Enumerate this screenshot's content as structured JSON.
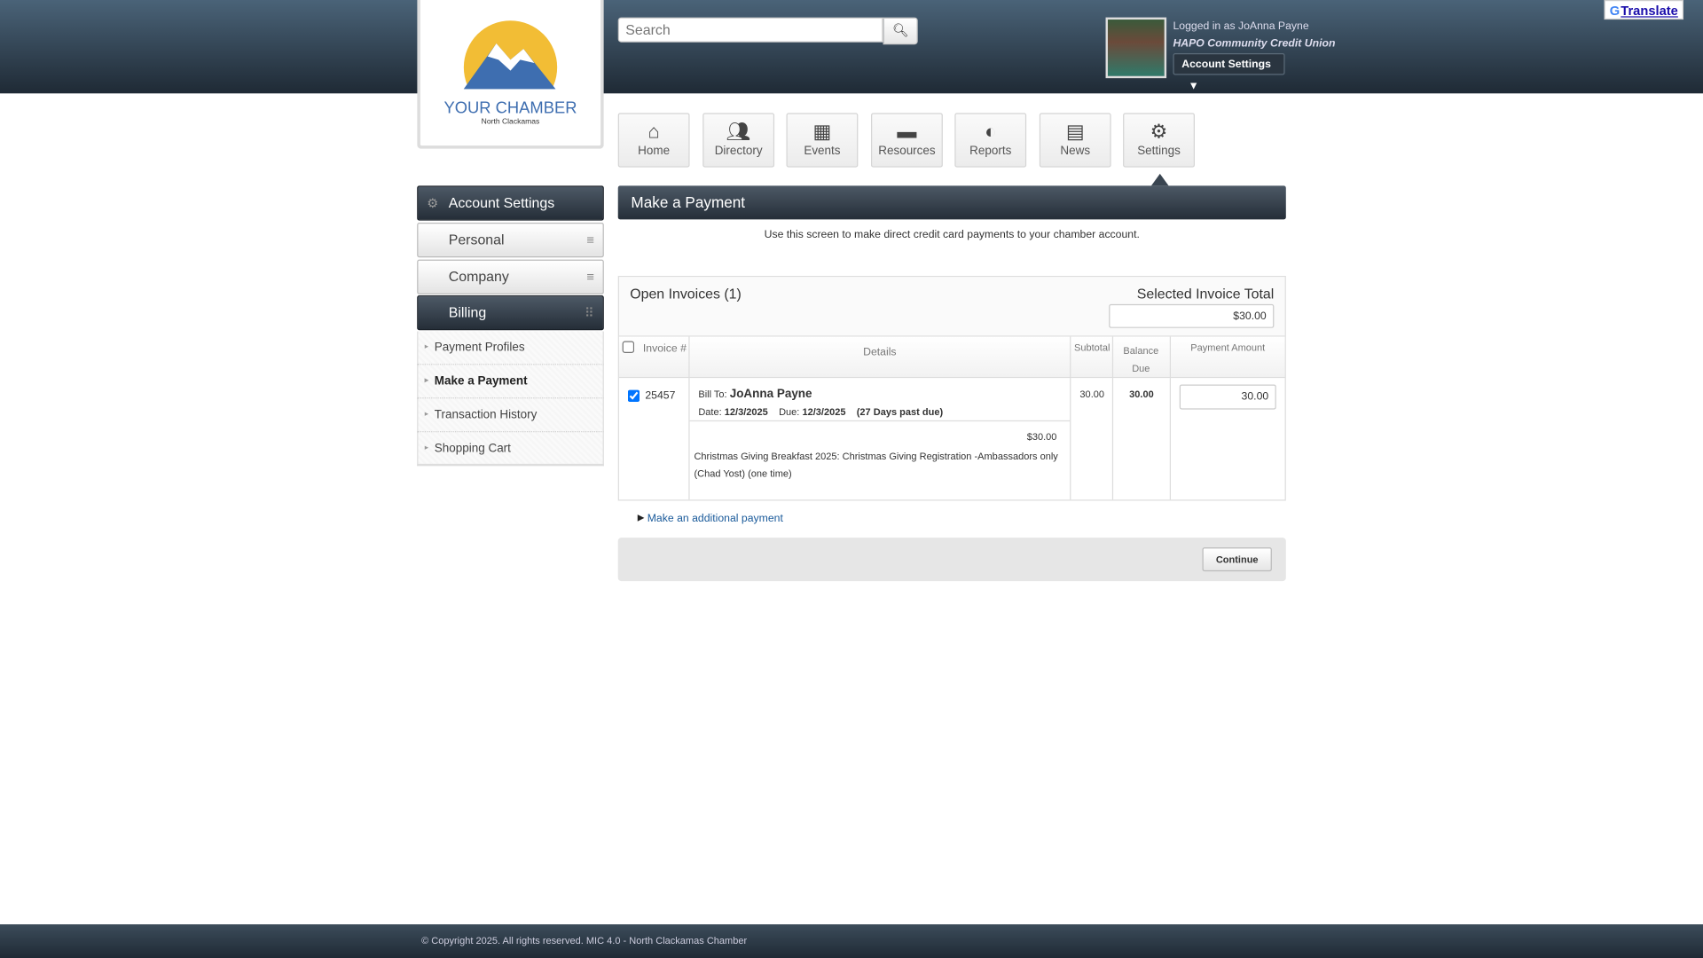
{
  "search": {
    "placeholder": "Search"
  },
  "user": {
    "logged_in": "Logged in as JoAnna Payne",
    "org": "HAPO Community Credit Union",
    "account_settings": "Account Settings"
  },
  "translate": "Translate",
  "logo": {
    "line1": "YOUR CHAMBER",
    "line2": "North Clackamas"
  },
  "nav": [
    {
      "label": "Home",
      "icon": "home-icon"
    },
    {
      "label": "Directory",
      "icon": "people-icon"
    },
    {
      "label": "Events",
      "icon": "calendar-icon"
    },
    {
      "label": "Resources",
      "icon": "folder-icon"
    },
    {
      "label": "Reports",
      "icon": "pie-icon"
    },
    {
      "label": "News",
      "icon": "news-icon"
    },
    {
      "label": "Settings",
      "icon": "gear-icon"
    }
  ],
  "sidebar": {
    "title": "Account Settings",
    "sections": [
      "Personal",
      "Company",
      "Billing"
    ],
    "billing_items": [
      "Payment Profiles",
      "Make a Payment",
      "Transaction History",
      "Shopping Cart"
    ]
  },
  "main": {
    "title": "Make a Payment",
    "intro": "Use this screen to make direct credit card payments to your chamber account.",
    "open_invoices": "Open Invoices (1)",
    "selected_total_label": "Selected Invoice Total",
    "selected_total": "$30.00",
    "columns": [
      "Invoice #",
      "Details",
      "Subtotal",
      "Balance Due",
      "Payment Amount"
    ],
    "invoice": {
      "number": "25457",
      "bill_to_label": "Bill To:",
      "bill_to": "JoAnna Payne",
      "date_label": "Date:",
      "date": "12/3/2025",
      "due_label": "Due:",
      "due": "12/3/2025",
      "past_due": "(27 Days past due)",
      "line_amount": "$30.00",
      "line_desc": "Christmas Giving Breakfast 2025: Christmas Giving Registration -Ambassadors only (Chad Yost) (one time)",
      "subtotal": "30.00",
      "balance": "30.00",
      "payment": "30.00"
    },
    "additional": "Make an additional payment",
    "continue": "Continue"
  },
  "footer": "© Copyright 2025. All rights reserved. MIC 4.0 - North Clackamas Chamber"
}
